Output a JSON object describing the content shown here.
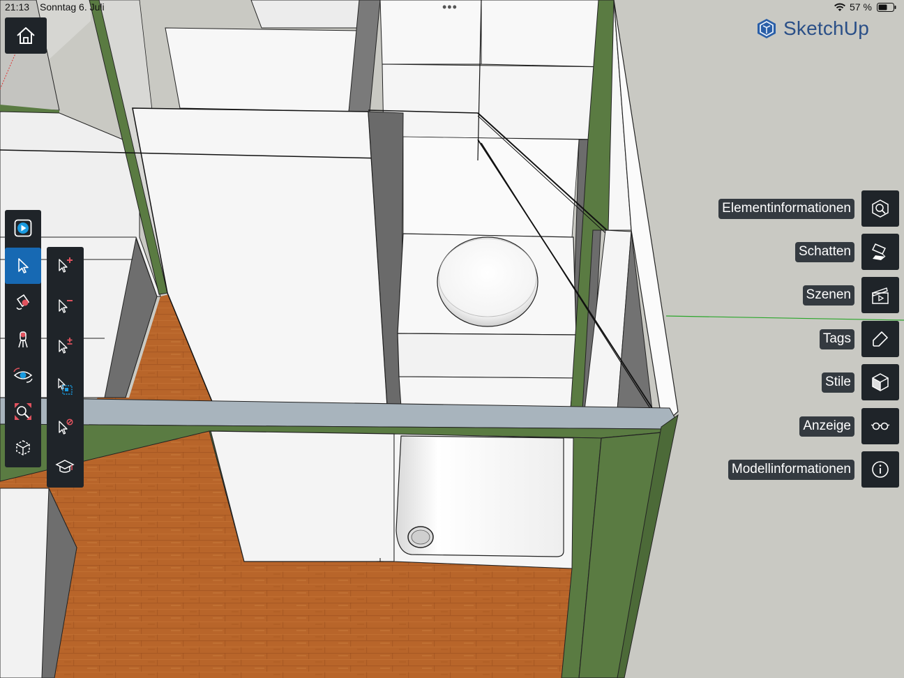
{
  "status_bar": {
    "time": "21:13",
    "date": "Sonntag 6. Juli",
    "battery": "57 %",
    "more_dots": "•••"
  },
  "brand": {
    "name": "SketchUp",
    "logo_icon": "sketchup-logo-icon"
  },
  "home_button": {
    "icon": "home-icon"
  },
  "left_toolbar": {
    "tools": [
      {
        "icon": "play-icon",
        "active": false
      },
      {
        "icon": "select-arrow-icon",
        "active": true
      },
      {
        "icon": "paint-bucket-icon",
        "active": false
      },
      {
        "icon": "walk-icon",
        "active": false
      },
      {
        "icon": "orbit-eye-icon",
        "active": false
      },
      {
        "icon": "zoom-extents-icon",
        "active": false
      },
      {
        "icon": "views-cube-icon",
        "active": false
      }
    ]
  },
  "select_flyout": {
    "tools": [
      {
        "icon": "select-add-icon"
      },
      {
        "icon": "select-subtract-icon"
      },
      {
        "icon": "select-toggle-icon"
      },
      {
        "icon": "select-window-icon"
      },
      {
        "icon": "select-none-icon"
      },
      {
        "icon": "instructor-icon"
      }
    ]
  },
  "right_panels": [
    {
      "label": "Elementinformationen",
      "icon": "entity-info-icon"
    },
    {
      "label": "Schatten",
      "icon": "shadow-icon"
    },
    {
      "label": "Szenen",
      "icon": "scenes-clapper-icon"
    },
    {
      "label": "Tags",
      "icon": "tag-icon"
    },
    {
      "label": "Stile",
      "icon": "styles-icon"
    },
    {
      "label": "Anzeige",
      "icon": "glasses-icon"
    },
    {
      "label": "Modellinformationen",
      "icon": "info-icon"
    }
  ],
  "colors": {
    "toolbar_bg": "#1f2429",
    "active_tool": "#1769b3",
    "brand_blue": "#2a4f87",
    "wall_green": "#5a7b42",
    "floor_wood": "#b8652a",
    "background": "#c9c9c3",
    "accent_red": "#e0525e"
  }
}
